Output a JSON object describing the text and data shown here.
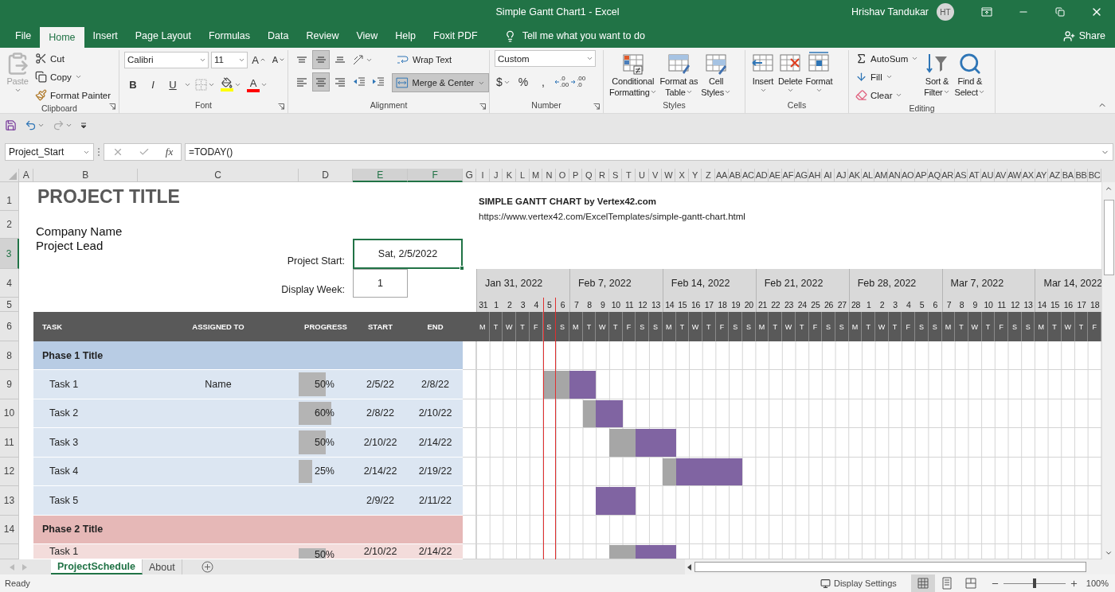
{
  "window": {
    "title": "Simple Gantt Chart1  -  Excel",
    "user": "Hrishav Tandukar",
    "initials": "HT"
  },
  "menu_tabs": [
    {
      "label": "File",
      "selected": false
    },
    {
      "label": "Home",
      "selected": true
    },
    {
      "label": "Insert",
      "selected": false
    },
    {
      "label": "Page Layout",
      "selected": false
    },
    {
      "label": "Formulas",
      "selected": false
    },
    {
      "label": "Data",
      "selected": false
    },
    {
      "label": "Review",
      "selected": false
    },
    {
      "label": "View",
      "selected": false
    },
    {
      "label": "Help",
      "selected": false
    },
    {
      "label": "Foxit PDF",
      "selected": false
    }
  ],
  "tell_me": "Tell me what you want to do",
  "share": "Share",
  "ribbon": {
    "clipboard": {
      "label": "Clipboard",
      "paste": {
        "label": "Paste",
        "disabled": true
      },
      "actions": [
        {
          "kind": "cut",
          "label": "Cut"
        },
        {
          "kind": "copy",
          "label": "Copy"
        },
        {
          "kind": "painter",
          "label": "Format Painter"
        }
      ]
    },
    "font": {
      "label": "Font",
      "font_name": "Calibri",
      "font_size": "11",
      "grow": "A",
      "shrink": "A",
      "styles": [
        {
          "kind": "bold",
          "label": "B"
        },
        {
          "kind": "italic",
          "label": "I"
        },
        {
          "kind": "underline",
          "label": "U"
        }
      ],
      "font_color_letter": "A"
    },
    "alignment": {
      "label": "Alignment",
      "vertical": [
        {
          "kind": "top",
          "selected": false
        },
        {
          "kind": "middle",
          "selected": true
        },
        {
          "kind": "bottom",
          "selected": false
        }
      ],
      "horizontal": [
        {
          "kind": "left",
          "selected": false
        },
        {
          "kind": "center",
          "selected": true
        },
        {
          "kind": "right",
          "selected": false
        }
      ],
      "wrap_text": "Wrap Text",
      "merge": {
        "label": "Merge & Center",
        "selected": true
      }
    },
    "number": {
      "label": "Number",
      "format": "Custom",
      "symbols": [
        "$",
        "%",
        ","
      ],
      "decimals": [
        {
          "kind": "increase",
          "top": ".0",
          "bottom": ".00"
        },
        {
          "kind": "decrease",
          "top": ".00",
          "bottom": ".0"
        }
      ]
    },
    "styles": {
      "label": "Styles",
      "buttons": [
        {
          "kind": "conditional",
          "lines": [
            "Conditional",
            "Formatting"
          ]
        },
        {
          "kind": "table",
          "lines": [
            "Format as",
            "Table"
          ]
        },
        {
          "kind": "cell",
          "lines": [
            "Cell",
            "Styles"
          ]
        }
      ]
    },
    "cells": {
      "label": "Cells",
      "buttons": [
        {
          "kind": "insert",
          "label": "Insert"
        },
        {
          "kind": "delete",
          "label": "Delete"
        },
        {
          "kind": "format",
          "label": "Format"
        }
      ]
    },
    "editing": {
      "label": "Editing",
      "actions": [
        {
          "kind": "autosum",
          "label": "AutoSum"
        },
        {
          "kind": "fill",
          "label": "Fill"
        },
        {
          "kind": "clear",
          "label": "Clear"
        }
      ],
      "buttons": [
        {
          "kind": "sort",
          "lines": [
            "Sort &",
            "Filter"
          ]
        },
        {
          "kind": "find",
          "lines": [
            "Find &",
            "Select"
          ]
        }
      ]
    }
  },
  "formula_bar": {
    "name_box": "Project_Start",
    "function_label": "fx",
    "formula": "=TODAY()"
  },
  "columns": [
    {
      "label": "A",
      "selected": false
    },
    {
      "label": "B",
      "selected": false
    },
    {
      "label": "C",
      "selected": false
    },
    {
      "label": "D",
      "selected": false
    },
    {
      "label": "E",
      "selected": true
    },
    {
      "label": "F",
      "selected": true
    },
    {
      "label": "G",
      "selected": false
    },
    {
      "label": "I",
      "selected": false
    },
    {
      "label": "J",
      "selected": false
    },
    {
      "label": "K",
      "selected": false
    },
    {
      "label": "L",
      "selected": false
    },
    {
      "label": "M",
      "selected": false
    },
    {
      "label": "N",
      "selected": false
    },
    {
      "label": "O",
      "selected": false
    },
    {
      "label": "P",
      "selected": false
    },
    {
      "label": "Q",
      "selected": false
    },
    {
      "label": "R",
      "selected": false
    },
    {
      "label": "S",
      "selected": false
    },
    {
      "label": "T",
      "selected": false
    },
    {
      "label": "U",
      "selected": false
    },
    {
      "label": "V",
      "selected": false
    },
    {
      "label": "W",
      "selected": false
    },
    {
      "label": "X",
      "selected": false
    },
    {
      "label": "Y",
      "selected": false
    },
    {
      "label": "Z",
      "selected": false
    },
    {
      "label": "AA",
      "selected": false
    },
    {
      "label": "AB",
      "selected": false
    },
    {
      "label": "AC",
      "selected": false
    },
    {
      "label": "AD",
      "selected": false
    },
    {
      "label": "AE",
      "selected": false
    },
    {
      "label": "AF",
      "selected": false
    },
    {
      "label": "AG",
      "selected": false
    },
    {
      "label": "AH",
      "selected": false
    },
    {
      "label": "AI",
      "selected": false
    },
    {
      "label": "AJ",
      "selected": false
    },
    {
      "label": "AK",
      "selected": false
    },
    {
      "label": "AL",
      "selected": false
    },
    {
      "label": "AM",
      "selected": false
    },
    {
      "label": "AN",
      "selected": false
    },
    {
      "label": "AO",
      "selected": false
    },
    {
      "label": "AP",
      "selected": false
    },
    {
      "label": "AQ",
      "selected": false
    },
    {
      "label": "AR",
      "selected": false
    },
    {
      "label": "AS",
      "selected": false
    },
    {
      "label": "AT",
      "selected": false
    },
    {
      "label": "AU",
      "selected": false
    },
    {
      "label": "AV",
      "selected": false
    },
    {
      "label": "AW",
      "selected": false
    },
    {
      "label": "AX",
      "selected": false
    },
    {
      "label": "AY",
      "selected": false
    },
    {
      "label": "AZ",
      "selected": false
    },
    {
      "label": "BA",
      "selected": false
    },
    {
      "label": "BB",
      "selected": false
    },
    {
      "label": "BC",
      "selected": false
    }
  ],
  "rows": [
    {
      "label": "1",
      "selected": false
    },
    {
      "label": "2",
      "selected": false
    },
    {
      "label": "3",
      "selected": true
    },
    {
      "label": "4",
      "selected": false
    },
    {
      "label": "5",
      "selected": false
    },
    {
      "label": "6",
      "selected": false
    },
    {
      "label": "8",
      "selected": false
    },
    {
      "label": "9",
      "selected": false
    },
    {
      "label": "10",
      "selected": false
    },
    {
      "label": "11",
      "selected": false
    },
    {
      "label": "12",
      "selected": false
    },
    {
      "label": "13",
      "selected": false
    },
    {
      "label": "14",
      "selected": false
    }
  ],
  "sheet": {
    "title": "PROJECT TITLE",
    "company": "Company Name",
    "lead": "Project Lead",
    "start_label": "Project Start:",
    "start_value": "Sat, 2/5/2022",
    "week_label": "Display Week:",
    "week_value": "1",
    "headers": [
      "TASK",
      "ASSIGNED TO",
      "PROGRESS",
      "START",
      "END"
    ],
    "groups": [
      {
        "title": "Phase 1 Title",
        "color": "#b8cce4",
        "tasks": [
          {
            "task": "Task 1",
            "assigned": "Name",
            "progress": "50%",
            "start": "2/5/22",
            "end": "2/8/22"
          },
          {
            "task": "Task 2",
            "progress": "60%",
            "start": "2/8/22",
            "end": "2/10/22"
          },
          {
            "task": "Task 3",
            "progress": "50%",
            "start": "2/10/22",
            "end": "2/14/22"
          },
          {
            "task": "Task 4",
            "progress": "25%",
            "start": "2/14/22",
            "end": "2/19/22"
          },
          {
            "task": "Task 5",
            "start": "2/9/22",
            "end": "2/11/22"
          }
        ]
      },
      {
        "title": "Phase 2 Title",
        "color": "#e6b8b7",
        "tasks": [
          {
            "task": "Task 1",
            "progress": "50%",
            "start": "2/10/22",
            "end": "2/14/22"
          }
        ]
      }
    ]
  },
  "gantt": {
    "heading": "SIMPLE GANTT CHART by Vertex42.com",
    "link": "https://www.vertex42.com/ExcelTemplates/simple-gantt-chart.html",
    "weeks": [
      "Jan 31, 2022",
      "Feb 7, 2022",
      "Feb 14, 2022",
      "Feb 21, 2022",
      "Feb 28, 2022",
      "Mar 7, 2022",
      "Mar 14, 2022"
    ],
    "days": [
      "31",
      "1",
      "2",
      "3",
      "4",
      "5",
      "6",
      "7",
      "8",
      "9",
      "10",
      "11",
      "12",
      "13",
      "14",
      "15",
      "16",
      "17",
      "18",
      "19",
      "20",
      "21",
      "22",
      "23",
      "24",
      "25",
      "26",
      "27",
      "28",
      "1",
      "2",
      "3",
      "4",
      "5",
      "6",
      "7",
      "8",
      "9",
      "10",
      "11",
      "12",
      "13",
      "14",
      "15",
      "16",
      "17",
      "18"
    ],
    "weekdays": [
      "M",
      "T",
      "W",
      "T",
      "F",
      "S",
      "S",
      "M",
      "T",
      "W",
      "T",
      "F",
      "S",
      "S",
      "M",
      "T",
      "W",
      "T",
      "F",
      "S",
      "S",
      "M",
      "T",
      "W",
      "T",
      "F",
      "S",
      "S",
      "M",
      "T",
      "W",
      "T",
      "F",
      "S",
      "S",
      "M",
      "T",
      "W",
      "T",
      "F",
      "S",
      "S",
      "M",
      "T",
      "W",
      "T",
      "F"
    ]
  },
  "sheet_tabs": [
    {
      "label": "ProjectSchedule",
      "selected": true
    },
    {
      "label": "About",
      "selected": false
    }
  ],
  "status_bar": {
    "text": "Ready",
    "display_settings": "Display Settings",
    "views": [
      {
        "kind": "normal",
        "selected": true
      },
      {
        "kind": "page_layout",
        "selected": false
      },
      {
        "kind": "page_break",
        "selected": false
      }
    ],
    "zoom": {
      "level": 0.5,
      "label": "100%"
    }
  }
}
